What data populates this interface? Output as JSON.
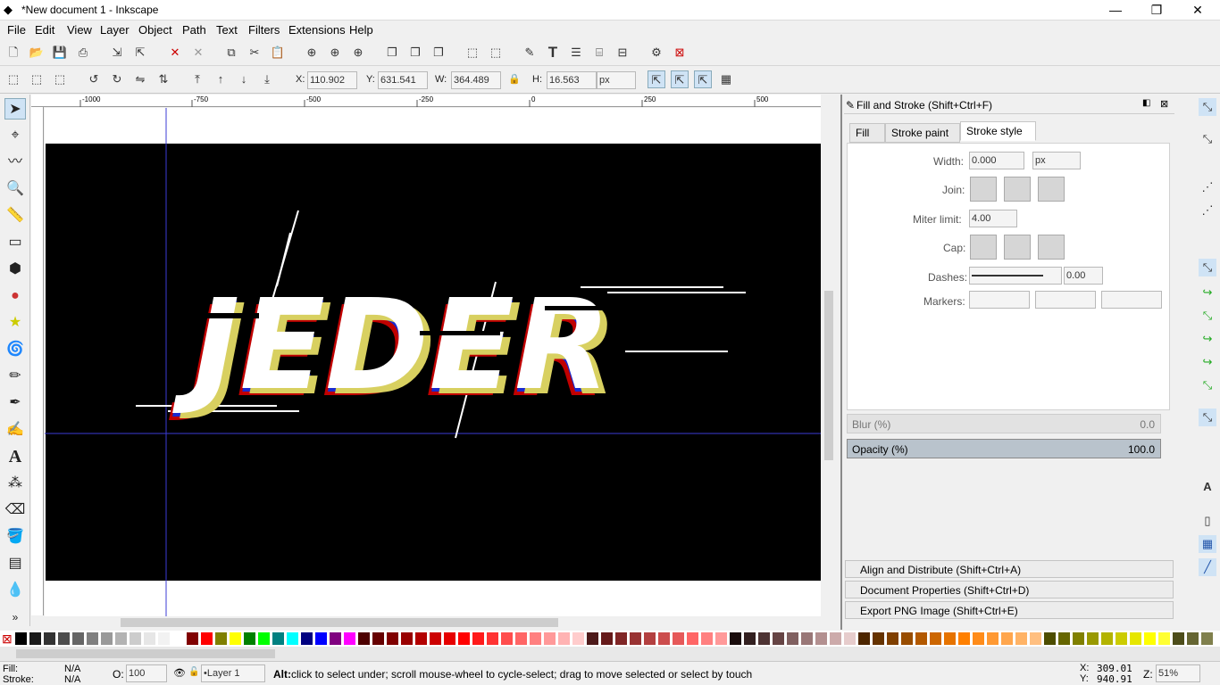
{
  "window": {
    "title": "*New document 1 - Inkscape",
    "min": "—",
    "max": "❐",
    "close": "✕"
  },
  "menu": [
    "File",
    "Edit",
    "View",
    "Layer",
    "Object",
    "Path",
    "Text",
    "Filters",
    "Extensions",
    "Help"
  ],
  "ctrl": {
    "x_label": "X:",
    "x": "110.902",
    "y_label": "Y:",
    "y": "631.541",
    "w_label": "W:",
    "w": "364.489",
    "h_label": "H:",
    "h": "16.563",
    "unit": "px"
  },
  "ruler": [
    "-1000",
    "-750",
    "-500",
    "-250",
    "0",
    "250",
    "500"
  ],
  "artwork_text": "JEDER",
  "dialog": {
    "title": "Fill and Stroke (Shift+Ctrl+F)",
    "tabs": [
      "Fill",
      "Stroke paint",
      "Stroke style"
    ],
    "width_label": "Width:",
    "width": "0.000",
    "width_unit": "px",
    "join_label": "Join:",
    "miter_label": "Miter limit:",
    "miter": "4.00",
    "cap_label": "Cap:",
    "dashes_label": "Dashes:",
    "dash_offset": "0.00",
    "markers_label": "Markers:",
    "blur_label": "Blur (%)",
    "blur": "0.0",
    "opacity_label": "Opacity (%)",
    "opacity": "100.0"
  },
  "docked": [
    "Align and Distribute (Shift+Ctrl+A)",
    "Document Properties (Shift+Ctrl+D)",
    "Export PNG Image (Shift+Ctrl+E)"
  ],
  "status": {
    "fill_label": "Fill:",
    "fill": "N/A",
    "stroke_label": "Stroke:",
    "stroke": "N/A",
    "o_label": "O:",
    "opacity": "100",
    "layer": "•Layer 1",
    "msg_bold": "Alt:",
    "msg": " click to select under; scroll mouse-wheel to cycle-select; drag to move selected or select by touch",
    "x_label": "X:",
    "x": "309.01",
    "y_label": "Y:",
    "y": "940.91",
    "z_label": "Z:",
    "zoom": "51%"
  },
  "palette_colors": [
    "#000000",
    "#1a1a1a",
    "#333333",
    "#4d4d4d",
    "#666666",
    "#808080",
    "#999999",
    "#b3b3b3",
    "#cccccc",
    "#e6e6e6",
    "#f2f2f2",
    "#ffffff",
    "#800000",
    "#ff0000",
    "#808000",
    "#ffff00",
    "#008000",
    "#00ff00",
    "#008080",
    "#00ffff",
    "#000080",
    "#0000ff",
    "#800080",
    "#ff00ff",
    "#4d0000",
    "#660000",
    "#800000",
    "#990000",
    "#b30000",
    "#cc0000",
    "#e60000",
    "#ff0000",
    "#ff1a1a",
    "#ff3333",
    "#ff4d4d",
    "#ff6666",
    "#ff8080",
    "#ff9999",
    "#ffb3b3",
    "#ffcccc",
    "#4d1a1a",
    "#661a1a",
    "#802626",
    "#993333",
    "#b34040",
    "#cc4d4d",
    "#e65959",
    "#ff6666",
    "#ff8080",
    "#ff9999",
    "#1a0d0d",
    "#332020",
    "#4d3333",
    "#664444",
    "#806060",
    "#997777",
    "#b39090",
    "#ccaaaa",
    "#e6cccc",
    "#4d2600",
    "#663300",
    "#804000",
    "#994d00",
    "#b35900",
    "#cc6600",
    "#e67300",
    "#ff8000",
    "#ff8c1a",
    "#ff9933",
    "#ffa64d",
    "#ffb366",
    "#ffbf80",
    "#4d4d00",
    "#666600",
    "#808000",
    "#999900",
    "#b3b300",
    "#cccc00",
    "#e6e600",
    "#ffff00",
    "#ffff33",
    "#4d4d1a",
    "#666633",
    "#80804d"
  ]
}
